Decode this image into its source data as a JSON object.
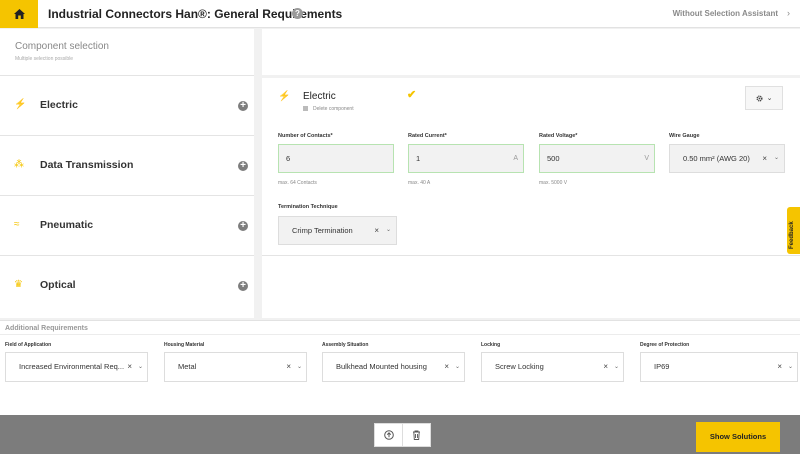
{
  "header": {
    "title": "Industrial Connectors Han®: General Requirements",
    "help_glyph": "?",
    "without_assistant": "Without Selection Assistant",
    "chevron": "›"
  },
  "sidebar": {
    "heading": "Component selection",
    "subheading": "Multiple selection possible",
    "items": [
      {
        "label": "Electric",
        "icon": "lightning-bolt-icon",
        "glyph": "⚡"
      },
      {
        "label": "Data Transmission",
        "icon": "network-nodes-icon",
        "glyph": "⁂"
      },
      {
        "label": "Pneumatic",
        "icon": "air-flow-icon",
        "glyph": "≈"
      },
      {
        "label": "Optical",
        "icon": "optical-fiber-icon",
        "glyph": "♛"
      }
    ],
    "add_glyph": "+"
  },
  "component": {
    "title": "Electric",
    "delete_label": "Delete component",
    "check_glyph": "✔",
    "fields": {
      "contacts": {
        "label": "Number of Contacts*",
        "value": "6",
        "hint": "max. 64 Contacts"
      },
      "current": {
        "label": "Rated Current*",
        "value": "1",
        "unit": "A",
        "hint": "max. 40 A"
      },
      "voltage": {
        "label": "Rated Voltage*",
        "value": "500",
        "unit": "V",
        "hint": "max. 5000 V"
      },
      "wire_gauge": {
        "label": "Wire Gauge",
        "value": "0.50 mm² (AWG 20)"
      },
      "termination": {
        "label": "Termination Technique",
        "value": "Crimp Termination"
      }
    }
  },
  "feedback": {
    "label": "Feedback"
  },
  "additional": {
    "title": "Additional Requirements",
    "items": [
      {
        "label": "Field of Application",
        "value": "Increased Environmental Req..."
      },
      {
        "label": "Housing Material",
        "value": "Metal"
      },
      {
        "label": "Assembly Situation",
        "value": "Bulkhead Mounted housing"
      },
      {
        "label": "Locking",
        "value": "Screw Locking"
      },
      {
        "label": "Degree of Protection",
        "value": "IP69"
      }
    ]
  },
  "footer": {
    "show_solutions": "Show Solutions"
  },
  "common": {
    "clear_glyph": "×",
    "caret_glyph": "⌄"
  },
  "colors": {
    "accent": "#f5c400",
    "valid_border": "#b7e3b1",
    "footer_bg": "#7c7c7c"
  }
}
